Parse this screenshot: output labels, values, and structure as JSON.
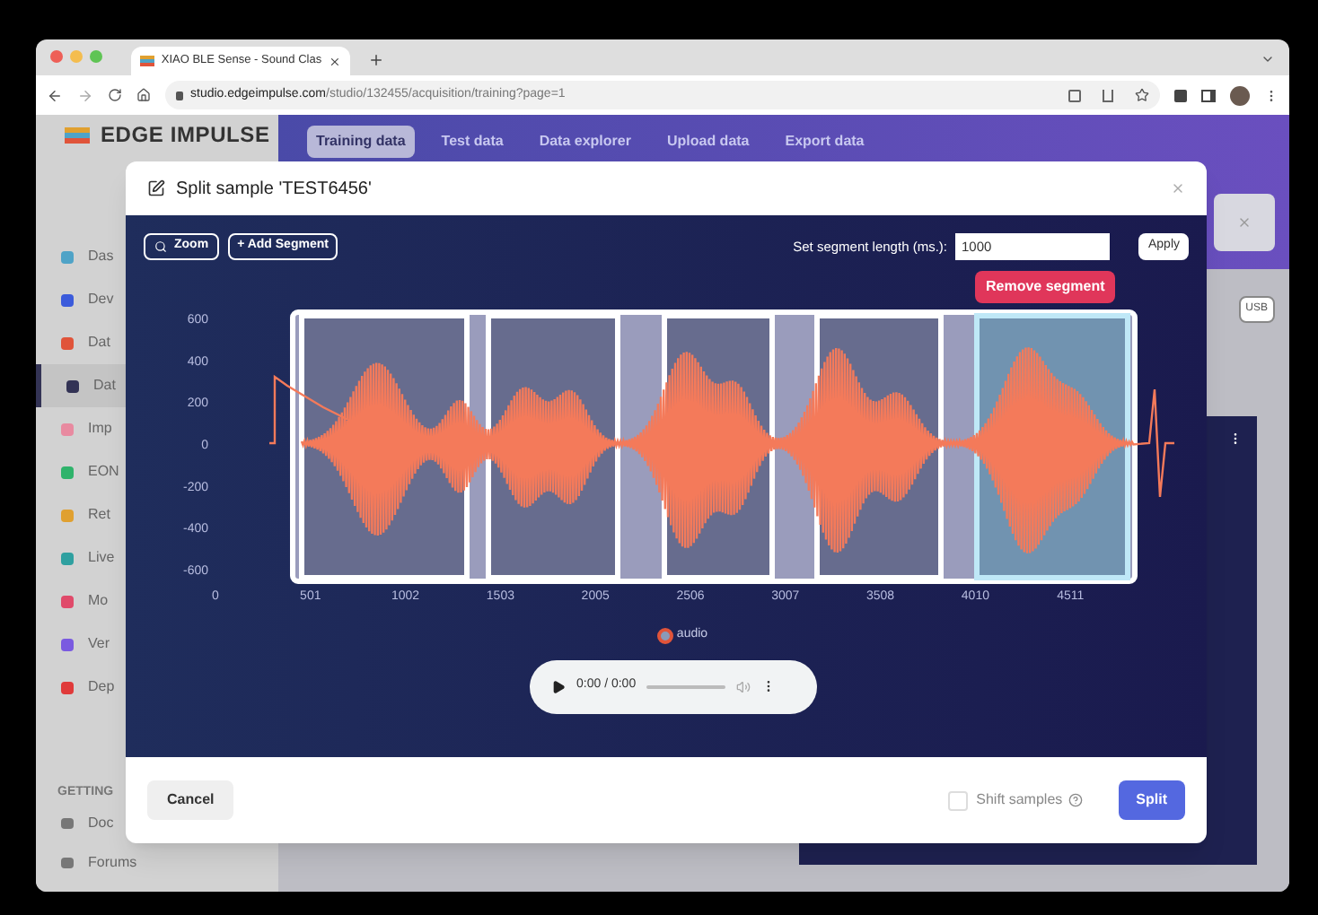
{
  "browser": {
    "tab_title": "XIAO BLE Sense - Sound Clas",
    "url_host": "studio.edgeimpulse.com",
    "url_path": "/studio/132455/acquisition/training?page=1"
  },
  "sidebar": {
    "logo": "EDGE IMPULSE",
    "items": [
      {
        "label": "Das",
        "selected": false,
        "color": "#4fa3c7"
      },
      {
        "label": "Dev",
        "selected": false,
        "color": "#3b5bdb"
      },
      {
        "label": "Dat",
        "selected": false,
        "color": "#e0543a"
      },
      {
        "label": "Dat",
        "selected": true,
        "color": "#333355"
      },
      {
        "label": "Imp",
        "selected": false,
        "color": "#e88aa0"
      },
      {
        "label": "EON",
        "selected": false,
        "color": "#2fb36b"
      },
      {
        "label": "Ret",
        "selected": false,
        "color": "#e0a030"
      },
      {
        "label": "Live",
        "selected": false,
        "color": "#2fa0a0"
      },
      {
        "label": "Mo",
        "selected": false,
        "color": "#e04a6a"
      },
      {
        "label": "Ver",
        "selected": false,
        "color": "#7a5ae0"
      },
      {
        "label": "Dep",
        "selected": false,
        "color": "#e03a3a"
      }
    ],
    "section": "GETTING",
    "links": [
      "Doc",
      "Forums"
    ]
  },
  "top_tabs": [
    {
      "label": "Training data",
      "selected": true
    },
    {
      "label": "Test data",
      "selected": false
    },
    {
      "label": "Data explorer",
      "selected": false
    },
    {
      "label": "Upload data",
      "selected": false
    },
    {
      "label": "Export data",
      "selected": false
    }
  ],
  "background_button": "USB",
  "modal": {
    "title": "Split sample 'TEST6456'",
    "toolbar": {
      "zoom": "Zoom",
      "add_segment": "+ Add Segment",
      "length_label": "Set segment length (ms.):",
      "length_value": "1000",
      "apply": "Apply"
    },
    "tooltip": "Remove segment",
    "y_ticks": [
      "600",
      "400",
      "200",
      "0",
      "-200",
      "-400",
      "-600"
    ],
    "x_ticks": [
      "0",
      "501",
      "1002",
      "1503",
      "2005",
      "2506",
      "3007",
      "3508",
      "4010",
      "4511"
    ],
    "segments": [
      {
        "selected": false
      },
      {
        "selected": false
      },
      {
        "selected": false
      },
      {
        "selected": false
      },
      {
        "selected": true
      }
    ],
    "legend": "audio",
    "player": {
      "time": "0:00 / 0:00"
    },
    "footer": {
      "cancel": "Cancel",
      "shift_label": "Shift samples",
      "shift_checked": false,
      "split": "Split"
    }
  }
}
